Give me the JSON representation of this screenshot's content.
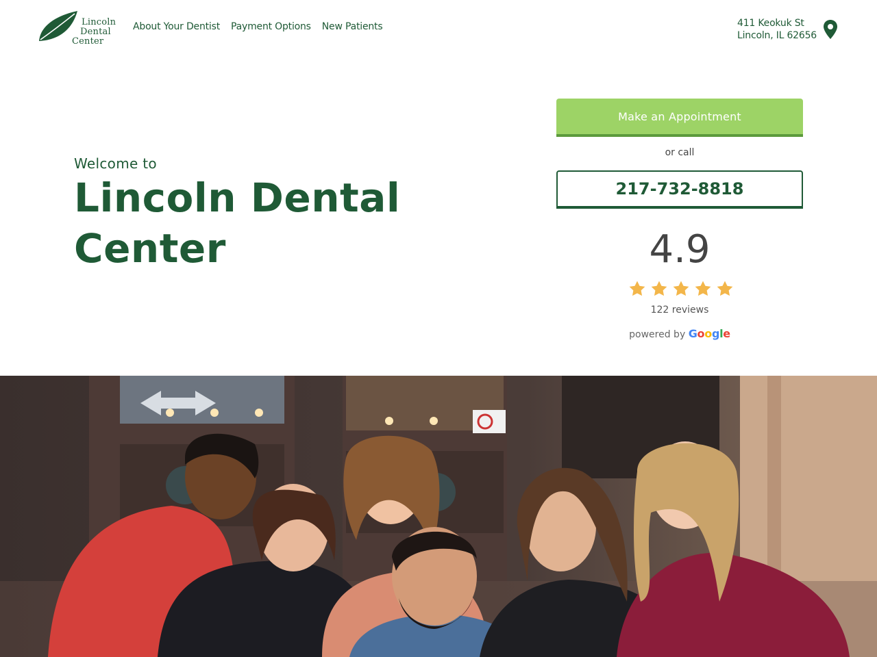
{
  "header": {
    "logo": {
      "line1": "Lincoln",
      "line2": "Dental",
      "line3": "Center"
    },
    "nav": [
      {
        "label": "About Your Dentist"
      },
      {
        "label": "Payment Options"
      },
      {
        "label": "New Patients"
      }
    ],
    "address": {
      "line1": "411 Keokuk St",
      "line2": "Lincoln, IL 62656"
    },
    "location_icon": "map-pin-icon"
  },
  "hero": {
    "welcome": "Welcome to",
    "title": "Lincoln Dental Center"
  },
  "cta": {
    "appointment_label": "Make an Appointment",
    "or_call": "or call",
    "phone": "217-732-8818"
  },
  "rating": {
    "score": "4.9",
    "stars": 5,
    "reviews": "122 reviews",
    "powered_by": "powered by",
    "provider": "Google"
  },
  "photo": {
    "subject": "team-photo"
  },
  "colors": {
    "brand_green": "#1f5a36",
    "button_green": "#9dd366",
    "star": "#f3b64a"
  }
}
